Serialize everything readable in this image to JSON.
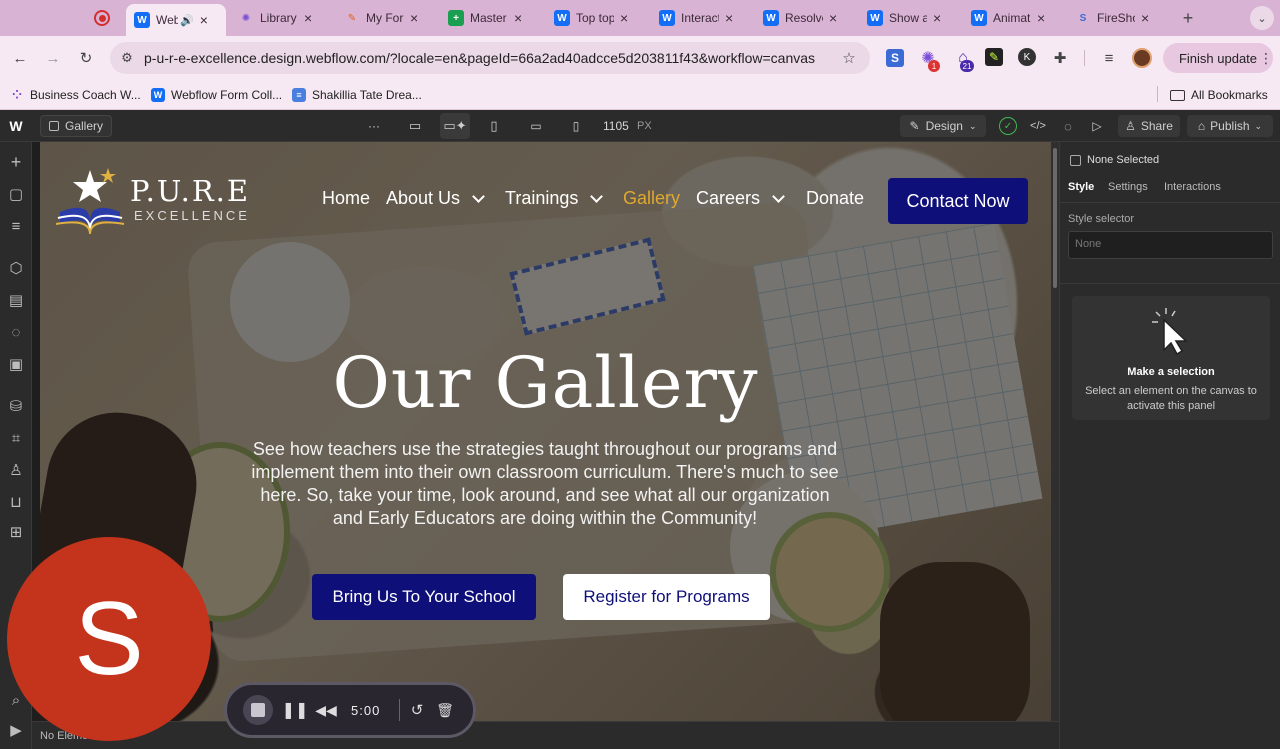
{
  "browser": {
    "tabs": [
      {
        "title": "Web",
        "icon": "webflow-icon"
      },
      {
        "title": "Library",
        "icon": "library-icon"
      },
      {
        "title": "My Form",
        "icon": "form-icon"
      },
      {
        "title": "Master",
        "icon": "sheets-icon"
      },
      {
        "title": "Top top",
        "icon": "webflow-icon"
      },
      {
        "title": "Interact",
        "icon": "webflow-icon"
      },
      {
        "title": "Resolve",
        "icon": "webflow-icon"
      },
      {
        "title": "Show a",
        "icon": "webflow-icon"
      },
      {
        "title": "Animat",
        "icon": "webflow-icon"
      },
      {
        "title": "FireSho",
        "icon": "fireshot-icon"
      }
    ],
    "url": "p-u-r-e-excellence.design.webflow.com/?locale=en&pageId=66a2ad40adcce5d203811f43&workflow=canvas",
    "finish_update": "Finish update",
    "bookmarks": [
      "Business Coach W...",
      "Webflow Form Coll...",
      "Shakillia Tate Drea..."
    ],
    "all_bookmarks": "All Bookmarks",
    "extension_badges": {
      "first": "1",
      "second": "21"
    }
  },
  "webflow": {
    "page_name": "Gallery",
    "more": "···",
    "canvas_width": "1105",
    "canvas_unit": "PX",
    "mode": "Design",
    "share": "Share",
    "publish": "Publish"
  },
  "site": {
    "logo_main": "P.U.R.E",
    "logo_sub": "EXCELLENCE",
    "nav": [
      "Home",
      "About Us",
      "Trainings",
      "Gallery",
      "Careers",
      "Donate"
    ],
    "contact": "Contact Now",
    "hero_title": "Our Gallery",
    "hero_text": "See how teachers use the strategies taught throughout our programs and implement them into their own classroom curriculum. There's much to see here. So, take your time, look around, and see what all our organization and Early Educators are doing within the Community!",
    "btn_school": "Bring Us To Your School",
    "btn_register": "Register for Programs",
    "active_nav_color": "#e0a830",
    "button_color": "#0f0f7a"
  },
  "right_panel": {
    "none_selected": "None Selected",
    "tabs": [
      "Style",
      "Settings",
      "Interactions"
    ],
    "style_selector_label": "Style selector",
    "style_selector_placeholder": "None",
    "make_selection_title": "Make a selection",
    "make_selection_text": "Select an element on the canvas to activate this panel"
  },
  "status": {
    "left_text": "No Element"
  },
  "avatar_letter": "S",
  "recorder": {
    "time": "5:00"
  }
}
